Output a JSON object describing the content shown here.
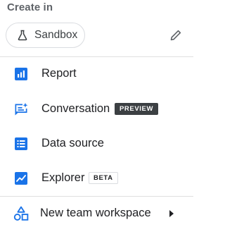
{
  "menu": {
    "heading": "Create in",
    "sandbox": {
      "label": "Sandbox",
      "icon": "flask-icon"
    },
    "edit_icon": "pencil-icon",
    "items": [
      {
        "label": "Report",
        "icon": "bar-chart-icon"
      },
      {
        "label": "Conversation",
        "icon": "chat-sparkle-icon",
        "badge": "PREVIEW"
      },
      {
        "label": "Data source",
        "icon": "list-icon"
      },
      {
        "label": "Explorer",
        "icon": "line-chart-icon",
        "badge": "BETA"
      }
    ],
    "new_workspace": {
      "label": "New team workspace",
      "icon": "shapes-icon",
      "submenu_icon": "caret-right-icon"
    }
  },
  "colors": {
    "accent": "#1a73e8",
    "text": "#202124",
    "muted": "#5f6368",
    "divider": "#e0e0e0",
    "preview_badge_bg": "#3c4043"
  }
}
